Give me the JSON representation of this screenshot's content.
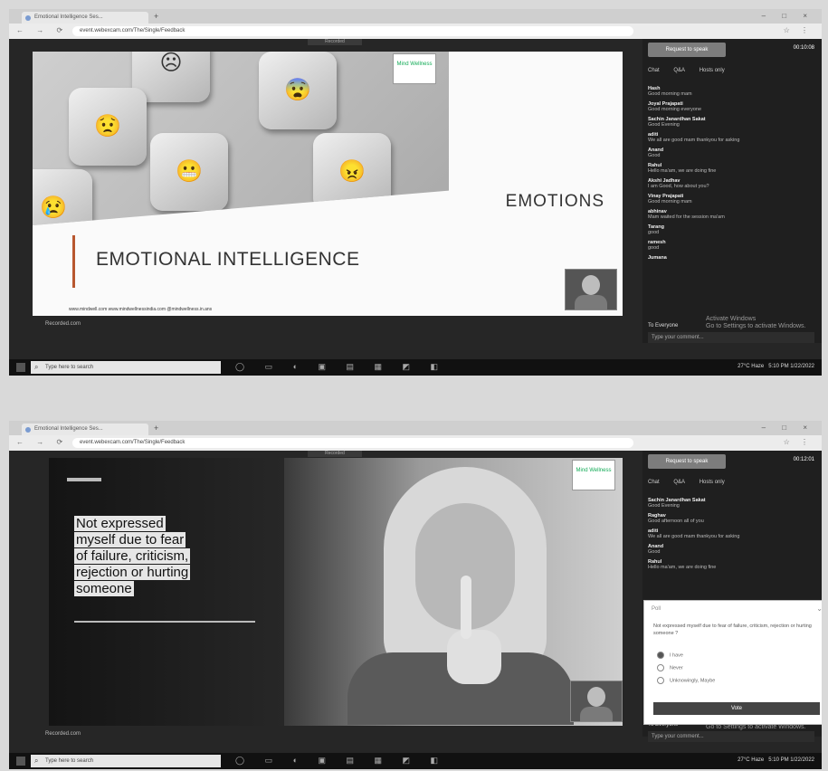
{
  "browser": {
    "tab_title": "Emotional Intelligence Ses...",
    "url": "event.webexcam.com/The/Single/Feedback",
    "new_tab": "+",
    "window_controls": "– □ ×",
    "nav_icons": "← → ⟳",
    "ext_icons": "☆ ⋮"
  },
  "app": {
    "recording_label": "Recorded",
    "request_to_speak": "Request to speak",
    "timer": "00:10:08",
    "timer2": "00:12:01",
    "chat_tabs": [
      "Chat",
      "Q&A",
      "Hosts only"
    ],
    "to_everyone": "To Everyone",
    "type_message": "Type your comment...",
    "activate_windows_1": "Activate Windows",
    "activate_windows_2": "Go to Settings to activate Windows."
  },
  "chat1": [
    {
      "name": "Hash",
      "text": "Good morning mam"
    },
    {
      "name": "Joyal Prajapati",
      "text": "Good morning everyone"
    },
    {
      "name": "Sachin Janardhan Sakat",
      "text": "Good Evening"
    },
    {
      "name": "aditi",
      "text": "We all are good mam thankyou for asking"
    },
    {
      "name": "Anand",
      "text": "Good"
    },
    {
      "name": "Rahul",
      "text": "Hello ma'am, we are doing fine"
    },
    {
      "name": "Akshi Jadhav",
      "text": "I am Good, how about you?"
    },
    {
      "name": "Vinay Prajapati",
      "text": "Good morning mam"
    },
    {
      "name": "abhinav",
      "text": "Mam waited for the session ma'am"
    },
    {
      "name": "Tarang",
      "text": "good"
    },
    {
      "name": "ramesh",
      "text": "good"
    },
    {
      "name": "Jumana",
      "text": ""
    }
  ],
  "chat2": [
    {
      "name": "Sachin Janardhan Sakat",
      "text": "Good Evening"
    },
    {
      "name": "Raghav",
      "text": "Good afternoon all of you"
    },
    {
      "name": "aditi",
      "text": "We all are good mam thankyou for asking"
    },
    {
      "name": "Anand",
      "text": "Good"
    },
    {
      "name": "Rahul",
      "text": "Hello ma'am, we are doing fine"
    }
  ],
  "slide1": {
    "title": "EMOTIONS",
    "subtitle": "EMOTIONAL INTELLIGENCE",
    "logo": "Mind Wellness",
    "footer": "www.mindwell.com   www.mindwellnessindia.com   @mindwellness.in.ans"
  },
  "slide2": {
    "quote_lines": [
      "Not expressed",
      "myself due to fear",
      "of failure, criticism,",
      "rejection or hurting",
      "someone"
    ],
    "logo": "Mind Wellness"
  },
  "poll": {
    "header": "Poll",
    "question": "Not expressed myself due to fear of failure, criticism, rejection or hurting someone ?",
    "options": [
      "I have",
      "Never",
      "Unknowingly, Maybe"
    ],
    "selected": 0,
    "vote_label": "Vote"
  },
  "taskbar": {
    "search": "Type here to search",
    "weather": "27°C Haze",
    "time": "5:10 PM",
    "date": "1/22/2022"
  },
  "recording_small": "Recorded.com"
}
